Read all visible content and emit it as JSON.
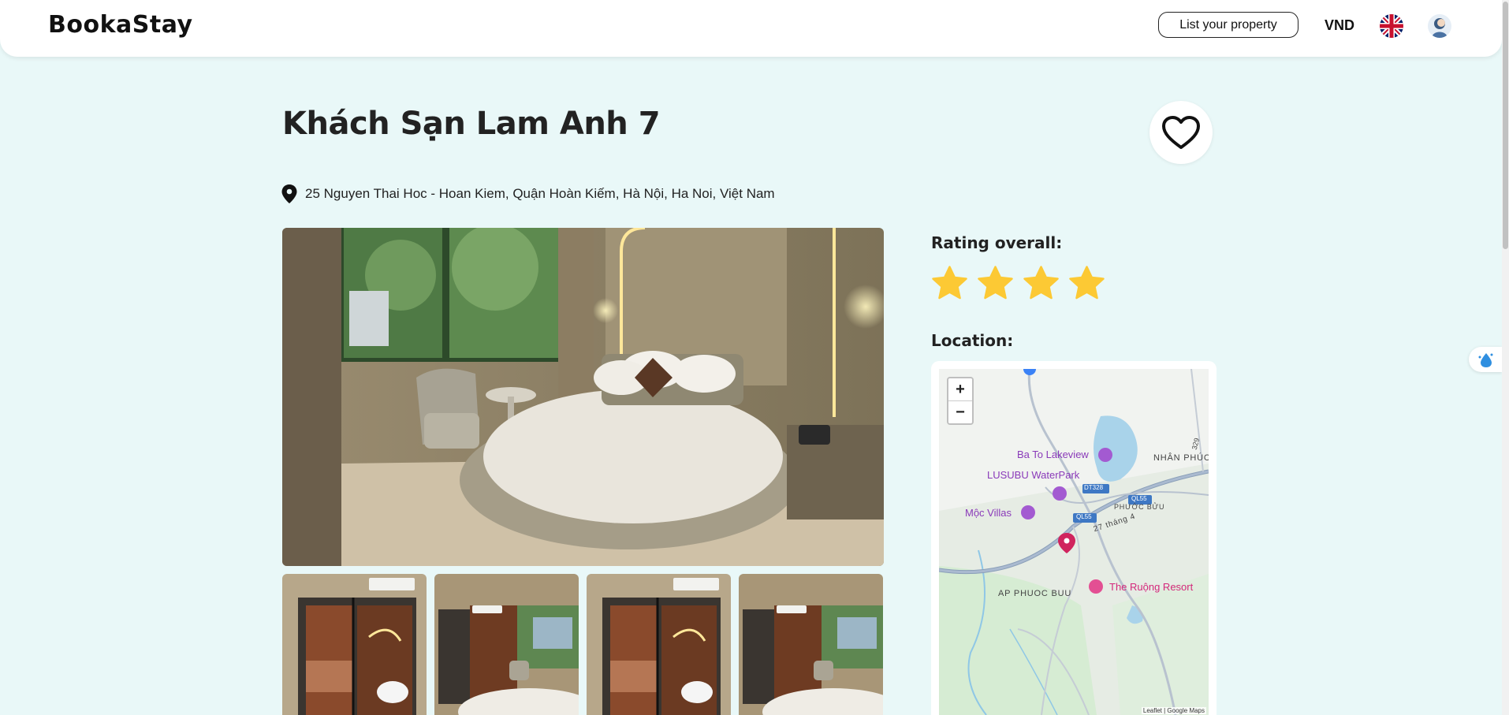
{
  "header": {
    "logo": "BookaStay",
    "list_property_label": "List your property",
    "currency": "VND",
    "language_icon": "uk-flag-icon",
    "avatar_icon": "user-avatar-icon"
  },
  "hotel": {
    "name": "Khách Sạn Lam Anh 7",
    "address": "25 Nguyen Thai Hoc - Hoan Kiem, Quận Hoàn Kiếm, Hà Nội, Ha Noi, Việt Nam",
    "favorite_icon": "heart-outline-icon",
    "location_icon": "map-pin-icon"
  },
  "gallery": {
    "main_photo": "hotel-room-round-bed-photo",
    "thumbnails": [
      "bathroom-glass-door-photo",
      "room-with-window-photo",
      "bathroom-glass-door-photo",
      "room-with-window-photo"
    ]
  },
  "rating": {
    "label": "Rating overall:",
    "stars": 4,
    "star_color": "#fcc934"
  },
  "location": {
    "label": "Location:",
    "map": {
      "zoom_in": "+",
      "zoom_out": "−",
      "pois": [
        {
          "name": "Ba To Lakeview",
          "type": "purple"
        },
        {
          "name": "LUSUBU WaterPark",
          "type": "purple"
        },
        {
          "name": "Mộc Villas",
          "type": "purple"
        },
        {
          "name": "The Ruộng Resort",
          "type": "pink"
        }
      ],
      "areas": [
        "NHÂN PHÚC",
        "PHƯỚC BỬU",
        "AP PHUOC BUU"
      ],
      "streets": [
        "27 tháng 4"
      ],
      "road_shields": [
        "DT328",
        "QL55",
        "QL55",
        "329"
      ],
      "attribution": "Leaflet | Google Maps"
    }
  },
  "colors": {
    "page_background": "#e9f8f8",
    "marker": "#d0245e"
  }
}
